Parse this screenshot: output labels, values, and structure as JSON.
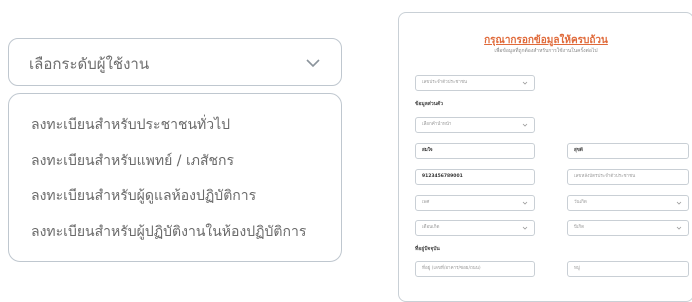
{
  "role_select": {
    "label": "เลือกระดับผู้ใช้งาน"
  },
  "role_options": [
    "ลงทะเบียนสำหรับประชาชนทั่วไป",
    "ลงทะเบียนสำหรับแพทย์ / เภสัชกร",
    "ลงทะเบียนสำหรับผู้ดูแลห้องปฏิบัติการ",
    "ลงทะเบียนสำหรับผู้ปฏิบัติงานในห้องปฏิบัติการ"
  ],
  "form": {
    "title": "กรุณากรอกข้อมูลให้ครบถ้วน",
    "subtitle": "เพื่อข้อมูลที่ถูกต้องสำหรับการใช้งานในครั้งต่อไป",
    "id_type": "เลขประจำตัวประชาชน",
    "section_personal": "ข้อมูลส่วนตัว",
    "prefix": "เลือกคำนำหน้า",
    "first_name": "สมใจ",
    "last_name": "สุขดี",
    "id_number": "9123456789001",
    "laser_placeholder": "เลขหลังบัตรประจำตัวประชาชน",
    "gender": "เพศ",
    "birth_day": "วันเกิด",
    "month": "เดือนเกิด",
    "year": "ปีเกิด",
    "section_address": "ที่อยู่ปัจจุบัน",
    "address_placeholder": "ที่อยู่ (เลขที่/อาคาร/ซอย/ถนน)",
    "moo_placeholder": "หมู่"
  },
  "colors": {
    "accent": "#e06a3a",
    "border": "#bfc7cf"
  }
}
